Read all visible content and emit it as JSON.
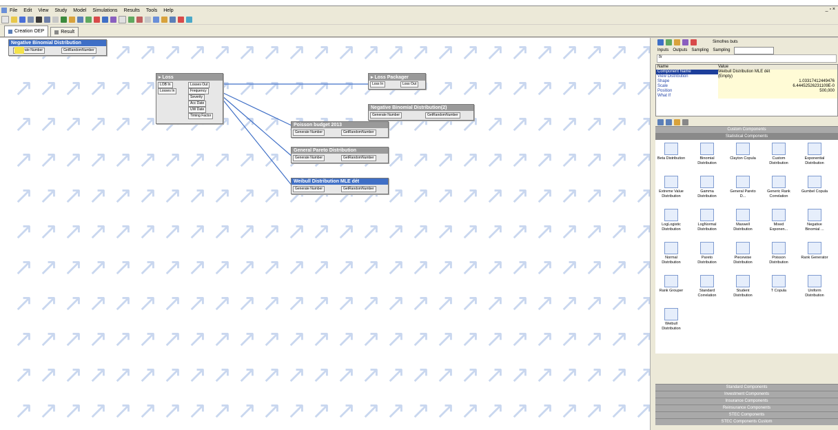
{
  "menu": [
    "File",
    "Edit",
    "View",
    "Study",
    "Model",
    "Simulations",
    "Results",
    "Tools",
    "Help"
  ],
  "window_controls": "_ ▫ ×",
  "tabs": [
    {
      "label": "Creation OEP"
    },
    {
      "label": "Result"
    }
  ],
  "nodes": {
    "neg_binom_top": {
      "title": "Negative Binomial Distribution",
      "ports": [
        "Generate Number",
        "GetRandomNumber"
      ]
    },
    "loss": {
      "title": "Loss",
      "ports": [
        "LOB In",
        "Losses In",
        "Losses Out",
        "Frequency",
        "Severity",
        "Acc Date",
        "UW Date",
        "Timing Factor"
      ]
    },
    "loss_packager": {
      "title": "Loss Packager",
      "ports": [
        "Loss In",
        "Loss Out"
      ]
    },
    "neg_binom_2": {
      "title": "Negative Binomial Distribution(2)",
      "ports": [
        "Generate Number",
        "GetRandomNumber"
      ]
    },
    "poisson": {
      "title": "Poisson budget 2013",
      "ports": [
        "Generate Number",
        "GetRandomNumber"
      ]
    },
    "gen_pareto": {
      "title": "General Pareto Distribution",
      "ports": [
        "Generate Number",
        "GetRandomNumber"
      ]
    },
    "weibull": {
      "title": "Weibull Distribution MLE dét",
      "ports": [
        "Generate Number",
        "GetRandomNumber"
      ]
    }
  },
  "panel": {
    "toolbar_text": "Simofres buts",
    "inputs_tab": "Inputs",
    "outputs_tab": "Outputs",
    "sampling_tab": "Sampling",
    "sampling_label": "Sampling",
    "fx": "fx",
    "grid_headers": [
      "Name",
      "Value"
    ],
    "grid": [
      {
        "k": "Component Name",
        "v": "Weibull Distribution MLE dét"
      },
      {
        "k": "View Distribution",
        "v": "(Empty)"
      },
      {
        "k": "Shape",
        "v": "1.03317412449476"
      },
      {
        "k": "Scale",
        "v": "6.44452526231109E-0"
      },
      {
        "k": "Position",
        "v": "500,000"
      },
      {
        "k": "What If",
        "v": ""
      }
    ],
    "sections_top": [
      "Custom Components",
      "Statistical Components"
    ],
    "components": [
      "Beta Distribution",
      "Binomial Distribution",
      "Clayton Copula",
      "Custom Distribution",
      "Exponential Distribution",
      "Extreme Value Distribution",
      "Gamma Distribution",
      "General Pareto D...",
      "Generic Rank Correlation",
      "Gumbel Copula",
      "LogLogistic Distribution",
      "LogNormal Distribution",
      "Maxwell Distribution",
      "Mixed Exponen...",
      "Negative Binomial ...",
      "Normal Distribution",
      "Pareto Distribution",
      "Piecewise Distribution",
      "Poisson Distribution",
      "Rank Generator",
      "Rank Grouper",
      "Standard Correlation",
      "Student Distribution",
      "T Copula",
      "Uniform Distribution",
      "Weibull Distribution"
    ],
    "sections_bottom": [
      "Standard Components",
      "Investment Components",
      "Insurance Components",
      "Reinsurance Components",
      "STEC Components",
      "STEC Components Custom"
    ]
  }
}
